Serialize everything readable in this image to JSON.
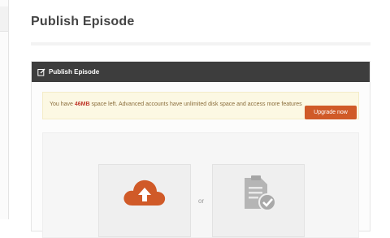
{
  "page": {
    "title": "Publish Episode"
  },
  "panel": {
    "header_title": "Publish Episode",
    "header_icon": "edit-icon"
  },
  "alert": {
    "prefix": "You have ",
    "quota": "46MB",
    "suffix": " space left. Advanced accounts have unlimited disk space and access more features",
    "button_label": "Upgrade now"
  },
  "upload": {
    "or_label": "or",
    "upload_icon": "cloud-upload-icon",
    "import_icon": "document-check-icon"
  },
  "colors": {
    "header_bg": "#3d3d3d",
    "accent": "#d05a28",
    "alert_bg": "#fcf8e3",
    "quota": "#c0392b",
    "icon_gray": "#aaaaaa"
  }
}
